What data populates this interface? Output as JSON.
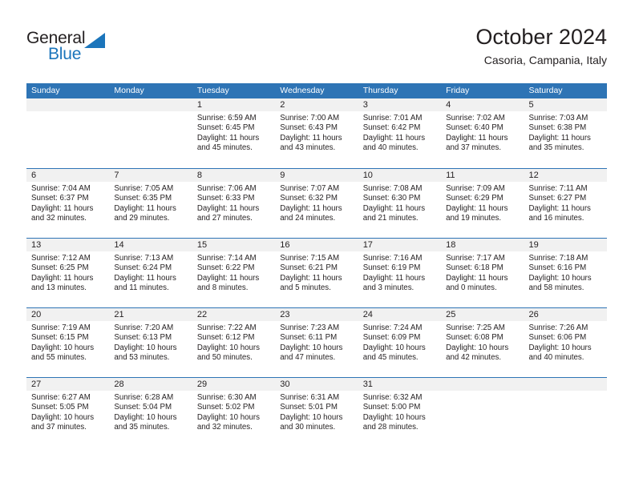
{
  "brand": {
    "name_top": "General",
    "name_bottom": "Blue",
    "accent_color": "#1b75bb"
  },
  "header": {
    "title": "October 2024",
    "subtitle": "Casoria, Campania, Italy"
  },
  "theme": {
    "header_bar_color": "#2e74b5",
    "day_number_band_color": "#f1f1f1",
    "text_color": "#231f20"
  },
  "calendar": {
    "weekday_headers": [
      "Sunday",
      "Monday",
      "Tuesday",
      "Wednesday",
      "Thursday",
      "Friday",
      "Saturday"
    ],
    "weeks": [
      [
        {
          "day": "",
          "sunrise": "",
          "sunset": "",
          "daylight": "",
          "empty": true
        },
        {
          "day": "",
          "sunrise": "",
          "sunset": "",
          "daylight": "",
          "empty": true
        },
        {
          "day": "1",
          "sunrise": "Sunrise: 6:59 AM",
          "sunset": "Sunset: 6:45 PM",
          "daylight": "Daylight: 11 hours and 45 minutes."
        },
        {
          "day": "2",
          "sunrise": "Sunrise: 7:00 AM",
          "sunset": "Sunset: 6:43 PM",
          "daylight": "Daylight: 11 hours and 43 minutes."
        },
        {
          "day": "3",
          "sunrise": "Sunrise: 7:01 AM",
          "sunset": "Sunset: 6:42 PM",
          "daylight": "Daylight: 11 hours and 40 minutes."
        },
        {
          "day": "4",
          "sunrise": "Sunrise: 7:02 AM",
          "sunset": "Sunset: 6:40 PM",
          "daylight": "Daylight: 11 hours and 37 minutes."
        },
        {
          "day": "5",
          "sunrise": "Sunrise: 7:03 AM",
          "sunset": "Sunset: 6:38 PM",
          "daylight": "Daylight: 11 hours and 35 minutes."
        }
      ],
      [
        {
          "day": "6",
          "sunrise": "Sunrise: 7:04 AM",
          "sunset": "Sunset: 6:37 PM",
          "daylight": "Daylight: 11 hours and 32 minutes."
        },
        {
          "day": "7",
          "sunrise": "Sunrise: 7:05 AM",
          "sunset": "Sunset: 6:35 PM",
          "daylight": "Daylight: 11 hours and 29 minutes."
        },
        {
          "day": "8",
          "sunrise": "Sunrise: 7:06 AM",
          "sunset": "Sunset: 6:33 PM",
          "daylight": "Daylight: 11 hours and 27 minutes."
        },
        {
          "day": "9",
          "sunrise": "Sunrise: 7:07 AM",
          "sunset": "Sunset: 6:32 PM",
          "daylight": "Daylight: 11 hours and 24 minutes."
        },
        {
          "day": "10",
          "sunrise": "Sunrise: 7:08 AM",
          "sunset": "Sunset: 6:30 PM",
          "daylight": "Daylight: 11 hours and 21 minutes."
        },
        {
          "day": "11",
          "sunrise": "Sunrise: 7:09 AM",
          "sunset": "Sunset: 6:29 PM",
          "daylight": "Daylight: 11 hours and 19 minutes."
        },
        {
          "day": "12",
          "sunrise": "Sunrise: 7:11 AM",
          "sunset": "Sunset: 6:27 PM",
          "daylight": "Daylight: 11 hours and 16 minutes."
        }
      ],
      [
        {
          "day": "13",
          "sunrise": "Sunrise: 7:12 AM",
          "sunset": "Sunset: 6:25 PM",
          "daylight": "Daylight: 11 hours and 13 minutes."
        },
        {
          "day": "14",
          "sunrise": "Sunrise: 7:13 AM",
          "sunset": "Sunset: 6:24 PM",
          "daylight": "Daylight: 11 hours and 11 minutes."
        },
        {
          "day": "15",
          "sunrise": "Sunrise: 7:14 AM",
          "sunset": "Sunset: 6:22 PM",
          "daylight": "Daylight: 11 hours and 8 minutes."
        },
        {
          "day": "16",
          "sunrise": "Sunrise: 7:15 AM",
          "sunset": "Sunset: 6:21 PM",
          "daylight": "Daylight: 11 hours and 5 minutes."
        },
        {
          "day": "17",
          "sunrise": "Sunrise: 7:16 AM",
          "sunset": "Sunset: 6:19 PM",
          "daylight": "Daylight: 11 hours and 3 minutes."
        },
        {
          "day": "18",
          "sunrise": "Sunrise: 7:17 AM",
          "sunset": "Sunset: 6:18 PM",
          "daylight": "Daylight: 11 hours and 0 minutes."
        },
        {
          "day": "19",
          "sunrise": "Sunrise: 7:18 AM",
          "sunset": "Sunset: 6:16 PM",
          "daylight": "Daylight: 10 hours and 58 minutes."
        }
      ],
      [
        {
          "day": "20",
          "sunrise": "Sunrise: 7:19 AM",
          "sunset": "Sunset: 6:15 PM",
          "daylight": "Daylight: 10 hours and 55 minutes."
        },
        {
          "day": "21",
          "sunrise": "Sunrise: 7:20 AM",
          "sunset": "Sunset: 6:13 PM",
          "daylight": "Daylight: 10 hours and 53 minutes."
        },
        {
          "day": "22",
          "sunrise": "Sunrise: 7:22 AM",
          "sunset": "Sunset: 6:12 PM",
          "daylight": "Daylight: 10 hours and 50 minutes."
        },
        {
          "day": "23",
          "sunrise": "Sunrise: 7:23 AM",
          "sunset": "Sunset: 6:11 PM",
          "daylight": "Daylight: 10 hours and 47 minutes."
        },
        {
          "day": "24",
          "sunrise": "Sunrise: 7:24 AM",
          "sunset": "Sunset: 6:09 PM",
          "daylight": "Daylight: 10 hours and 45 minutes."
        },
        {
          "day": "25",
          "sunrise": "Sunrise: 7:25 AM",
          "sunset": "Sunset: 6:08 PM",
          "daylight": "Daylight: 10 hours and 42 minutes."
        },
        {
          "day": "26",
          "sunrise": "Sunrise: 7:26 AM",
          "sunset": "Sunset: 6:06 PM",
          "daylight": "Daylight: 10 hours and 40 minutes."
        }
      ],
      [
        {
          "day": "27",
          "sunrise": "Sunrise: 6:27 AM",
          "sunset": "Sunset: 5:05 PM",
          "daylight": "Daylight: 10 hours and 37 minutes."
        },
        {
          "day": "28",
          "sunrise": "Sunrise: 6:28 AM",
          "sunset": "Sunset: 5:04 PM",
          "daylight": "Daylight: 10 hours and 35 minutes."
        },
        {
          "day": "29",
          "sunrise": "Sunrise: 6:30 AM",
          "sunset": "Sunset: 5:02 PM",
          "daylight": "Daylight: 10 hours and 32 minutes."
        },
        {
          "day": "30",
          "sunrise": "Sunrise: 6:31 AM",
          "sunset": "Sunset: 5:01 PM",
          "daylight": "Daylight: 10 hours and 30 minutes."
        },
        {
          "day": "31",
          "sunrise": "Sunrise: 6:32 AM",
          "sunset": "Sunset: 5:00 PM",
          "daylight": "Daylight: 10 hours and 28 minutes."
        },
        {
          "day": "",
          "sunrise": "",
          "sunset": "",
          "daylight": "",
          "empty": true
        },
        {
          "day": "",
          "sunrise": "",
          "sunset": "",
          "daylight": "",
          "empty": true
        }
      ]
    ]
  }
}
